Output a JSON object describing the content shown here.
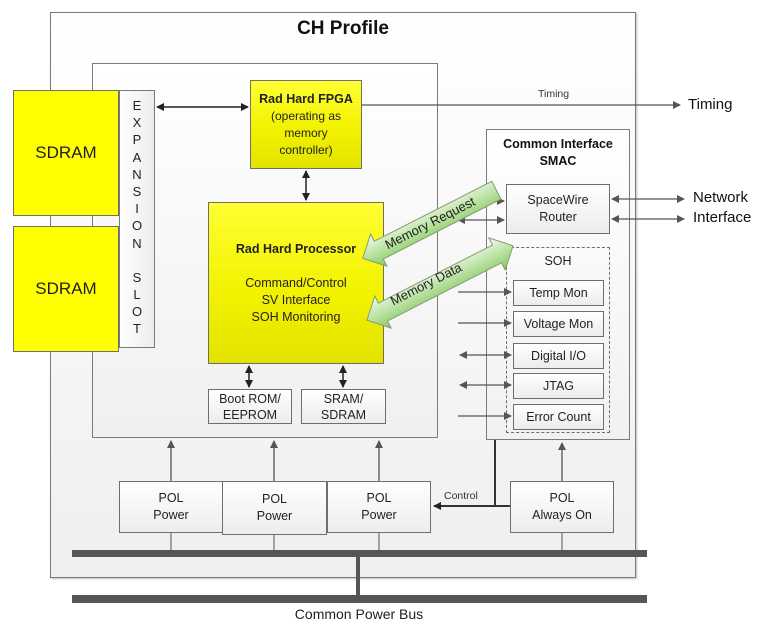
{
  "diagram": {
    "title": "CH Profile",
    "sdram_modules": [
      "SDRAM",
      "SDRAM"
    ],
    "expansion_slot": [
      "E",
      "X",
      "P",
      "A",
      "N",
      "S",
      "I",
      "O",
      "N",
      "",
      "S",
      "L",
      "O",
      "T"
    ],
    "fpga": {
      "title": "Rad Hard FPGA",
      "lines": [
        "(operating as",
        "memory",
        "controller)"
      ]
    },
    "processor": {
      "title": "Rad Hard Processor",
      "lines": [
        "Command/Control",
        "SV Interface",
        "SOH Monitoring"
      ]
    },
    "memories": [
      {
        "line1": "Boot ROM/",
        "line2": "EEPROM"
      },
      {
        "line1": "SRAM/",
        "line2": "SDRAM"
      }
    ],
    "arrows": {
      "memory_request": "Memory Request",
      "memory_data": "Memory Data"
    },
    "smac": {
      "title_line1": "Common Interface",
      "title_line2": "SMAC",
      "router_line1": "SpaceWire",
      "router_line2": "Router",
      "soh_label": "SOH",
      "soh_items": [
        "Temp Mon",
        "Voltage Mon",
        "Digital I/O",
        "JTAG",
        "Error Count"
      ]
    },
    "timing_small": "Timing",
    "timing_external": "Timing",
    "network_line1": "Network",
    "network_line2": "Interface",
    "control_label": "Control",
    "pol_units": [
      {
        "line1": "POL",
        "line2": "Power"
      },
      {
        "line1": "POL",
        "line2": "Power"
      },
      {
        "line1": "POL",
        "line2": "Power"
      },
      {
        "line1": "POL",
        "line2": "Always On"
      }
    ],
    "bus_label": "Common Power Bus",
    "colors": {
      "component_yellow": "#ffff00",
      "arrow_green": "#8fcf6a",
      "bus_gray": "#555555"
    }
  }
}
